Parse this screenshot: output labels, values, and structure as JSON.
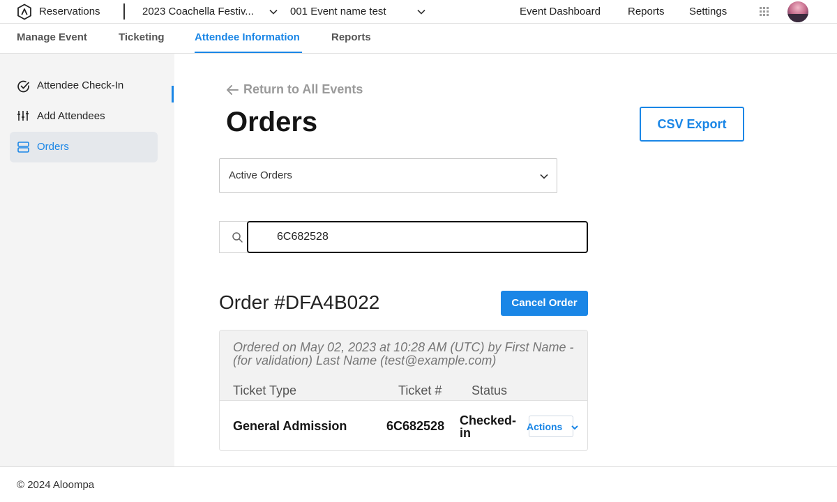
{
  "header": {
    "app_title": "Reservations",
    "event_select": "2023 Coachella Festiv...",
    "subevent_select": "001 Event name test",
    "nav": [
      "Event Dashboard",
      "Reports",
      "Settings"
    ],
    "icons": [
      "logo-icon",
      "apps-grid-icon",
      "avatar"
    ]
  },
  "tabs": {
    "items": [
      "Manage Event",
      "Ticketing",
      "Attendee Information",
      "Reports"
    ],
    "active": "Attendee Information"
  },
  "sidebar": {
    "items": [
      {
        "label": "Attendee Check-In",
        "icon": "check-circle-icon"
      },
      {
        "label": "Add Attendees",
        "icon": "sliders-icon"
      },
      {
        "label": "Orders",
        "icon": "server-icon",
        "active": true
      }
    ]
  },
  "main": {
    "return_link": "Return to All Events",
    "title": "Orders",
    "csv_export": "CSV Export",
    "filter": {
      "selected": "Active Orders"
    },
    "search": {
      "value": "6C682528"
    },
    "order": {
      "heading": "Order #DFA4B022",
      "cancel_label": "Cancel Order",
      "meta": "Ordered on May 02, 2023 at 10:28 AM (UTC) by First Name - (for validation) Last Name (test@example.com)",
      "columns": [
        "Ticket Type",
        "Ticket #",
        "Status"
      ],
      "rows": [
        {
          "ticket_type": "General Admission",
          "ticket_no": "6C682528",
          "status": "Checked-in",
          "action": "Actions"
        }
      ]
    }
  },
  "footer": {
    "text": "© 2024 Aloompa"
  },
  "colors": {
    "accent": "#1a86e6",
    "sidebar_bg": "#f4f4f4"
  }
}
